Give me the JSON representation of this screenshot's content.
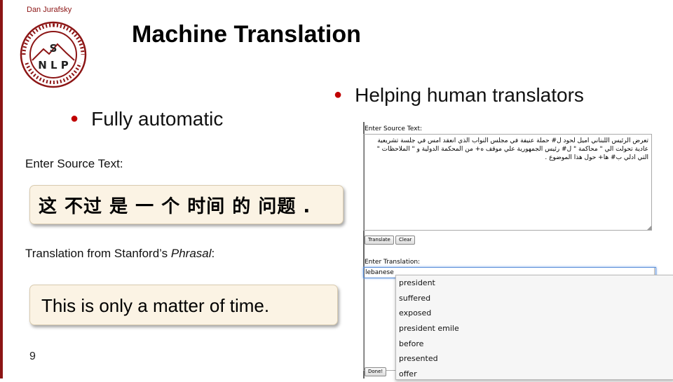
{
  "slide": {
    "author": "Dan Jurafsky",
    "title": "Machine Translation",
    "page_number": "9",
    "logo": {
      "top_text": "Stanford University",
      "bottom_text": "Natural Language Processing",
      "letters": "S NLP"
    }
  },
  "bullets": {
    "fully_automatic": "Fully automatic",
    "helping_translators": "Helping human translators"
  },
  "demo": {
    "source_label": "Enter Source Text:",
    "source_text": "这 不过 是 一 个 时间 的 问题 .",
    "translation_label_prefix": "Translation from Stanford’s ",
    "translation_label_italic": "Phrasal",
    "translation_label_suffix": ":",
    "translation_text": "This is only a matter of time."
  },
  "screenshot": {
    "source_label": "Enter Source Text:",
    "source_text": "تعرض الرئيس اللبناني اميل لحود ل# حملة عنيفة في مجلس النواب الذي انعقد امس في جلسة تشريعية عادية تحولت الي \" محاكمة \" ل# رئيس الجمهورية علي موقف ه+ من المحكمة الدولية و \" الملاحظات \" التي ادلي ب# ها+ حول هذا الموضوع .",
    "translate_button": "Translate",
    "clear_button": "Clear",
    "translation_label": "Enter Translation:",
    "translation_input": "lebanese",
    "suggestions": [
      "president",
      "suffered",
      "exposed",
      "president emile",
      "before",
      "presented",
      "offer"
    ],
    "done_button": "Done!"
  },
  "colors": {
    "brand": "#8c1515",
    "bullet": "#c00000",
    "box_fill": "#fbf3e4"
  }
}
